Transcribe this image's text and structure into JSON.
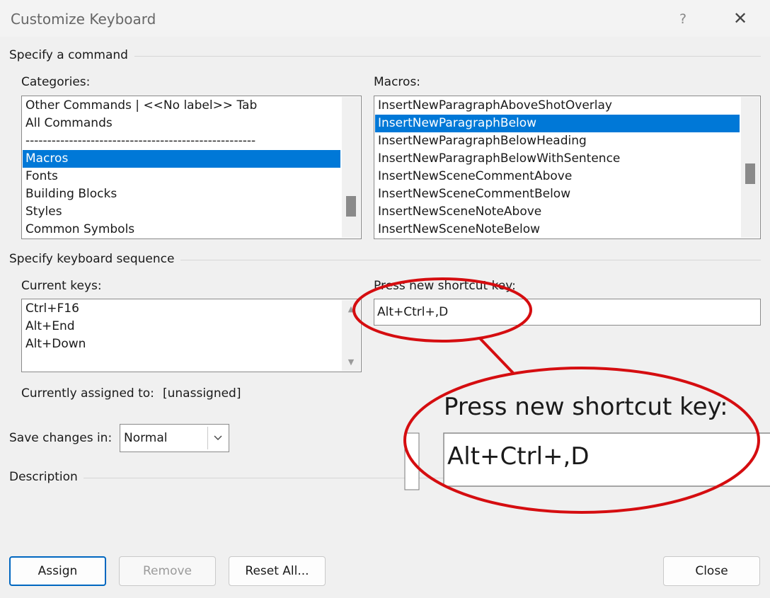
{
  "window": {
    "title": "Customize Keyboard",
    "help_label": "?",
    "close_label": "✕"
  },
  "specify_command": {
    "heading": "Specify a command",
    "categories": {
      "label": "Categories:",
      "items": [
        "Other Commands | <<No label>> Tab",
        "All Commands",
        "-----------------------------------------------------",
        "Macros",
        "Fonts",
        "Building Blocks",
        "Styles",
        "Common Symbols"
      ],
      "selected": "Macros"
    },
    "macros": {
      "label": "Macros:",
      "items": [
        "InsertNewParagraphAboveShotOverlay",
        "InsertNewParagraphBelow",
        "InsertNewParagraphBelowHeading",
        "InsertNewParagraphBelowWithSentence",
        "InsertNewSceneCommentAbove",
        "InsertNewSceneCommentBelow",
        "InsertNewSceneNoteAbove",
        "InsertNewSceneNoteBelow"
      ],
      "selected": "InsertNewParagraphBelow"
    }
  },
  "keyboard_sequence": {
    "heading": "Specify keyboard sequence",
    "current_keys": {
      "label": "Current keys:",
      "items": [
        "Ctrl+F16",
        "Alt+End",
        "Alt+Down"
      ]
    },
    "new_shortcut": {
      "label": "Press new shortcut key:",
      "value": "Alt+Ctrl+,D"
    },
    "currently_assigned_label": "Currently assigned to:",
    "currently_assigned_value": "[unassigned]"
  },
  "save_changes": {
    "label": "Save changes in:",
    "value": "Normal"
  },
  "description": {
    "heading": "Description"
  },
  "callout": {
    "label": "Press new shortcut key:",
    "value": "Alt+Ctrl+,D",
    "color": "#d50d10"
  },
  "buttons": {
    "assign": "Assign",
    "remove": "Remove",
    "reset_all": "Reset All...",
    "close": "Close"
  },
  "colors": {
    "selection": "#0078d7",
    "dialog_bg": "#f0f0f0",
    "annotation": "#d50d10"
  }
}
